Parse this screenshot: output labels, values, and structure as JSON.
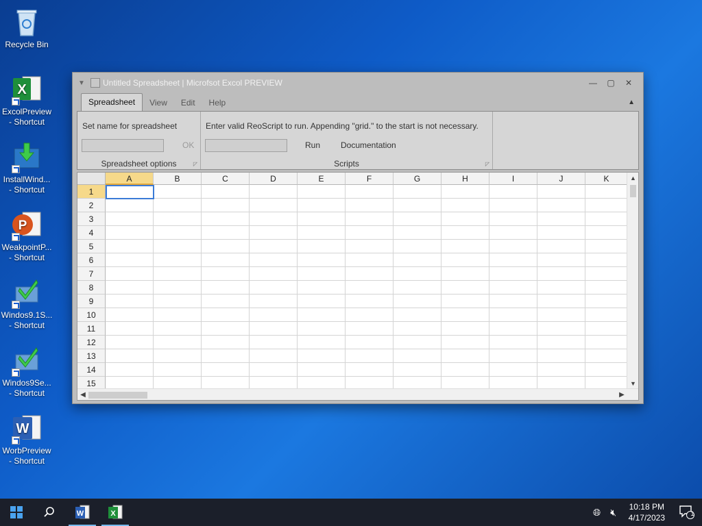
{
  "desktop": {
    "icons": [
      {
        "label1": "Recycle Bin",
        "label2": ""
      },
      {
        "label1": "ExcolPreview",
        "label2": "- Shortcut"
      },
      {
        "label1": "InstallWind...",
        "label2": "- Shortcut"
      },
      {
        "label1": "WeakpointP...",
        "label2": "- Shortcut"
      },
      {
        "label1": "Windos9.1S...",
        "label2": "- Shortcut"
      },
      {
        "label1": "Windos9Se...",
        "label2": "- Shortcut"
      },
      {
        "label1": "WorbPreview",
        "label2": "- Shortcut"
      }
    ]
  },
  "window": {
    "title": "Untitled Spreadsheet | Microfsot Excol PREVIEW",
    "tabs": [
      "Spreadsheet",
      "View",
      "Edit",
      "Help"
    ],
    "ribbon": {
      "name_text": "Set name for spreadsheet",
      "ok_label": "OK",
      "group1_label": "Spreadsheet options",
      "script_text": "Enter valid ReoScript to run. Appending \"grid.\" to the start is not necessary.",
      "run_label": "Run",
      "doc_label": "Documentation",
      "group2_label": "Scripts"
    },
    "grid": {
      "columns": [
        "A",
        "B",
        "C",
        "D",
        "E",
        "F",
        "G",
        "H",
        "I",
        "J",
        "K"
      ],
      "rows": [
        "1",
        "2",
        "3",
        "4",
        "5",
        "6",
        "7",
        "8",
        "9",
        "10",
        "11",
        "12",
        "13",
        "14",
        "15"
      ],
      "active_cell": "A1"
    }
  },
  "taskbar": {
    "time": "10:18 PM",
    "date": "4/17/2023",
    "notification_count": "1"
  },
  "colors": {
    "accent": "#3b7bd6",
    "selected_header": "#f6d98a",
    "taskbar": "#1b1f2a"
  }
}
